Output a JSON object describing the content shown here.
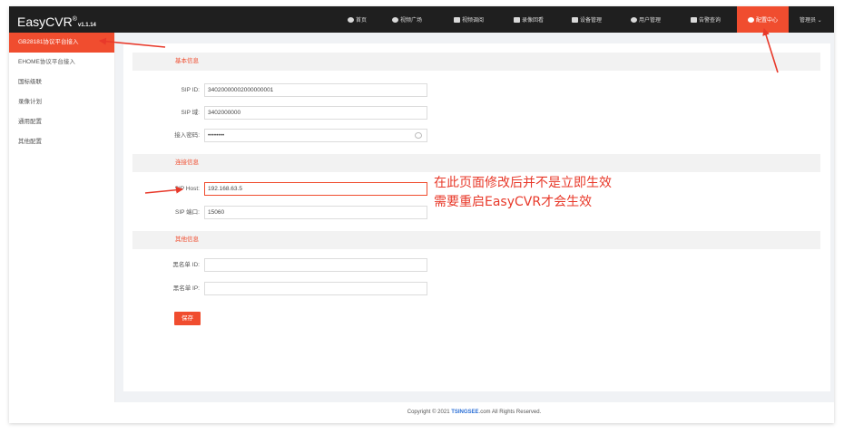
{
  "header": {
    "brand": "EasyCVR",
    "brand_mark": "®",
    "version": "v1.1.14",
    "nav": [
      {
        "label": "首页",
        "icon": "cloud-icon"
      },
      {
        "label": "视频广场",
        "icon": "play-circle-icon"
      },
      {
        "label": "视频调阅",
        "icon": "grid-icon"
      },
      {
        "label": "录像回看",
        "icon": "video-camera-icon"
      },
      {
        "label": "设备管理",
        "icon": "device-icon"
      },
      {
        "label": "用户管理",
        "icon": "user-icon"
      },
      {
        "label": "告警查询",
        "icon": "alarm-icon"
      },
      {
        "label": "配置中心",
        "icon": "gear-icon"
      }
    ],
    "user_menu": "管理员 ⌄"
  },
  "sidebar": {
    "items": [
      {
        "label": "GB28181协议平台接入"
      },
      {
        "label": "EHOME协议平台接入"
      },
      {
        "label": "国标级联"
      },
      {
        "label": "录像计划"
      },
      {
        "label": "通用配置"
      },
      {
        "label": "其他配置"
      }
    ]
  },
  "form": {
    "sections": {
      "basic": "基本信息",
      "connection": "连接信息",
      "other": "其他信息"
    },
    "fields": {
      "sip_id": {
        "label": "SIP ID:",
        "value": "34020000002000000001"
      },
      "sip_domain": {
        "label": "SIP 域:",
        "value": "3402000000"
      },
      "access_password": {
        "label": "接入密码:",
        "value": "••••••••"
      },
      "sip_host": {
        "label": "SIP Host:",
        "value": "192.168.63.5"
      },
      "sip_port": {
        "label": "SIP 端口:",
        "value": "15060"
      },
      "blacklist_id": {
        "label": "黑名单 ID:",
        "value": ""
      },
      "blacklist_ip": {
        "label": "黑名单 IP:",
        "value": ""
      }
    },
    "save_label": "保存"
  },
  "annotation": {
    "line1": "在此页面修改后并不是立即生效",
    "line2": "需要重启EasyCVR才会生效",
    "color": "#e8392a"
  },
  "footer": {
    "prefix": "Copyright © 2021 ",
    "brand": "TSINGSEE",
    "suffix": ".com All Rights Reserved."
  },
  "colors": {
    "accent": "#f04d2f",
    "header_bg": "#1f1f1f",
    "page_bg": "#f0f2f5"
  }
}
